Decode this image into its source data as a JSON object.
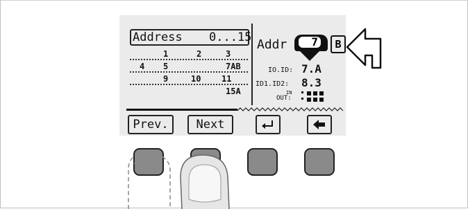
{
  "header": {
    "title": "Address",
    "range": "0...15"
  },
  "grid": {
    "rows": [
      [
        "",
        "1",
        "2",
        "3"
      ],
      [
        "4",
        "5",
        "",
        "7AB"
      ],
      [
        "",
        "9",
        "10",
        "11"
      ],
      [
        "",
        "",
        "",
        "15A"
      ]
    ]
  },
  "addr": {
    "label": "Addr",
    "value": "7",
    "suffix": "B"
  },
  "ids": {
    "label1": "IO.ID:",
    "value1": "7.A",
    "label2": "ID1.ID2:",
    "value2": "8.3",
    "label3_top": "IN",
    "label3_bottom": "OUT:"
  },
  "softkeys": {
    "prev": "Prev.",
    "next": "Next",
    "enter_icon": "enter-arrow",
    "back_icon": "back-arrow"
  }
}
